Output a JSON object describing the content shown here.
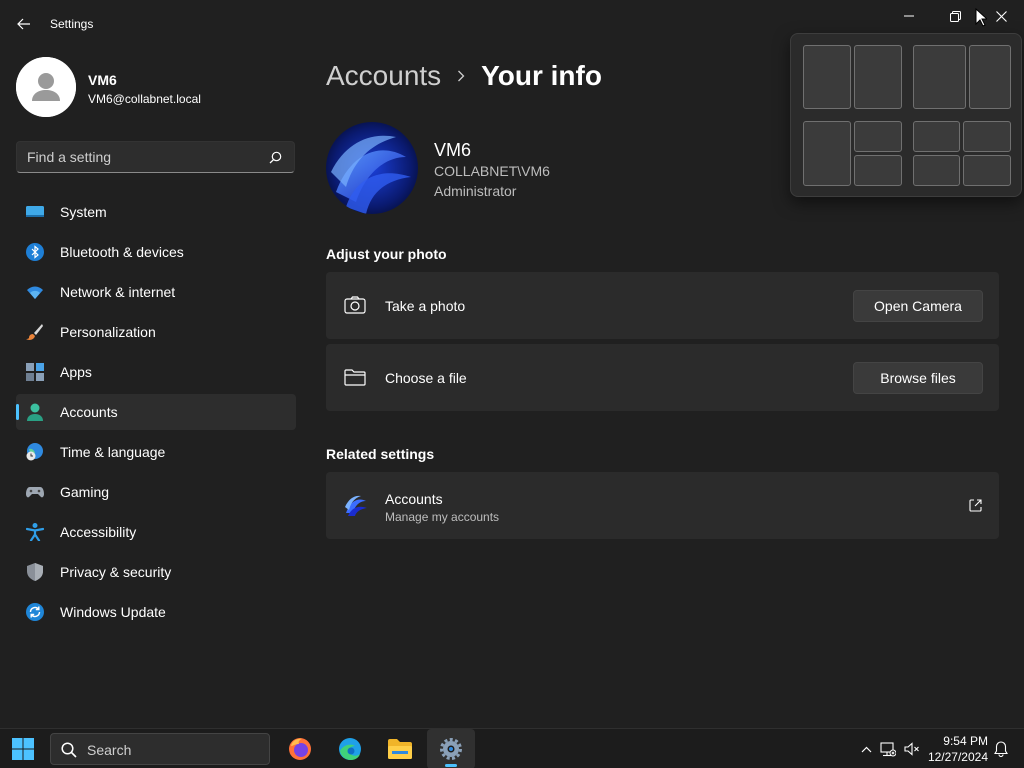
{
  "window": {
    "title": "Settings"
  },
  "profile": {
    "name": "VM6",
    "email": "VM6@collabnet.local"
  },
  "search": {
    "placeholder": "Find a setting"
  },
  "nav": {
    "items": [
      {
        "label": "System",
        "icon": "system-icon"
      },
      {
        "label": "Bluetooth & devices",
        "icon": "bluetooth-icon"
      },
      {
        "label": "Network & internet",
        "icon": "wifi-icon"
      },
      {
        "label": "Personalization",
        "icon": "brush-icon"
      },
      {
        "label": "Apps",
        "icon": "apps-icon"
      },
      {
        "label": "Accounts",
        "icon": "accounts-icon",
        "active": true
      },
      {
        "label": "Time & language",
        "icon": "globe-clock-icon"
      },
      {
        "label": "Gaming",
        "icon": "gamepad-icon"
      },
      {
        "label": "Accessibility",
        "icon": "accessibility-icon"
      },
      {
        "label": "Privacy & security",
        "icon": "shield-icon"
      },
      {
        "label": "Windows Update",
        "icon": "update-icon"
      }
    ]
  },
  "breadcrumb": {
    "parent": "Accounts",
    "current": "Your info"
  },
  "user": {
    "name": "VM6",
    "domain": "COLLABNET\\VM6",
    "role": "Administrator"
  },
  "adjust_photo": {
    "title": "Adjust your photo",
    "take_photo": {
      "label": "Take a photo",
      "button": "Open Camera"
    },
    "choose_file": {
      "label": "Choose a file",
      "button": "Browse files"
    }
  },
  "related": {
    "title": "Related settings",
    "accounts": {
      "label": "Accounts",
      "sub": "Manage my accounts"
    }
  },
  "taskbar": {
    "search_label": "Search",
    "time": "9:54 PM",
    "date": "12/27/2024",
    "apps": [
      "firefox-icon",
      "edge-icon",
      "file-explorer-icon",
      "settings-icon"
    ]
  },
  "colors": {
    "accent": "#4cc2ff",
    "background": "#202020",
    "card": "#2b2b2b"
  }
}
